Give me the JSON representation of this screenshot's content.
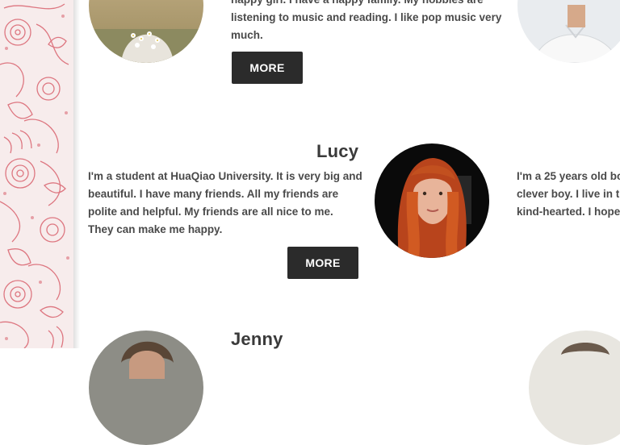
{
  "profiles": {
    "top": {
      "bio": "happy girl. I have a happy family. My hobbies are listening to music and reading. I like pop music very much.",
      "line1": "happy girl. I have a happy family. My hobbies are",
      "line2": "listening to music and reading. I like pop music very",
      "line3": "much.",
      "more_label": "MORE"
    },
    "lucy": {
      "name": "Lucy",
      "line1": "I'm a student at HuaQiao University. It is very big and",
      "line2": "beautiful. I have many friends. All my friends are",
      "line3": "polite and helpful. My friends are all nice to me.",
      "line4": "They can make me happy.",
      "more_label": "MORE"
    },
    "right_partial": {
      "line1": "I'm a 25 years old bo",
      "line2": "clever boy. I live in t",
      "line3": "kind-hearted. I hope"
    },
    "jenny": {
      "name": "Jenny"
    }
  },
  "colors": {
    "button_bg": "#2b2b2b",
    "button_text": "#ffffff",
    "text": "#4a4a4a",
    "floral_accent": "#d9626e",
    "floral_bg": "#f7ecec"
  }
}
